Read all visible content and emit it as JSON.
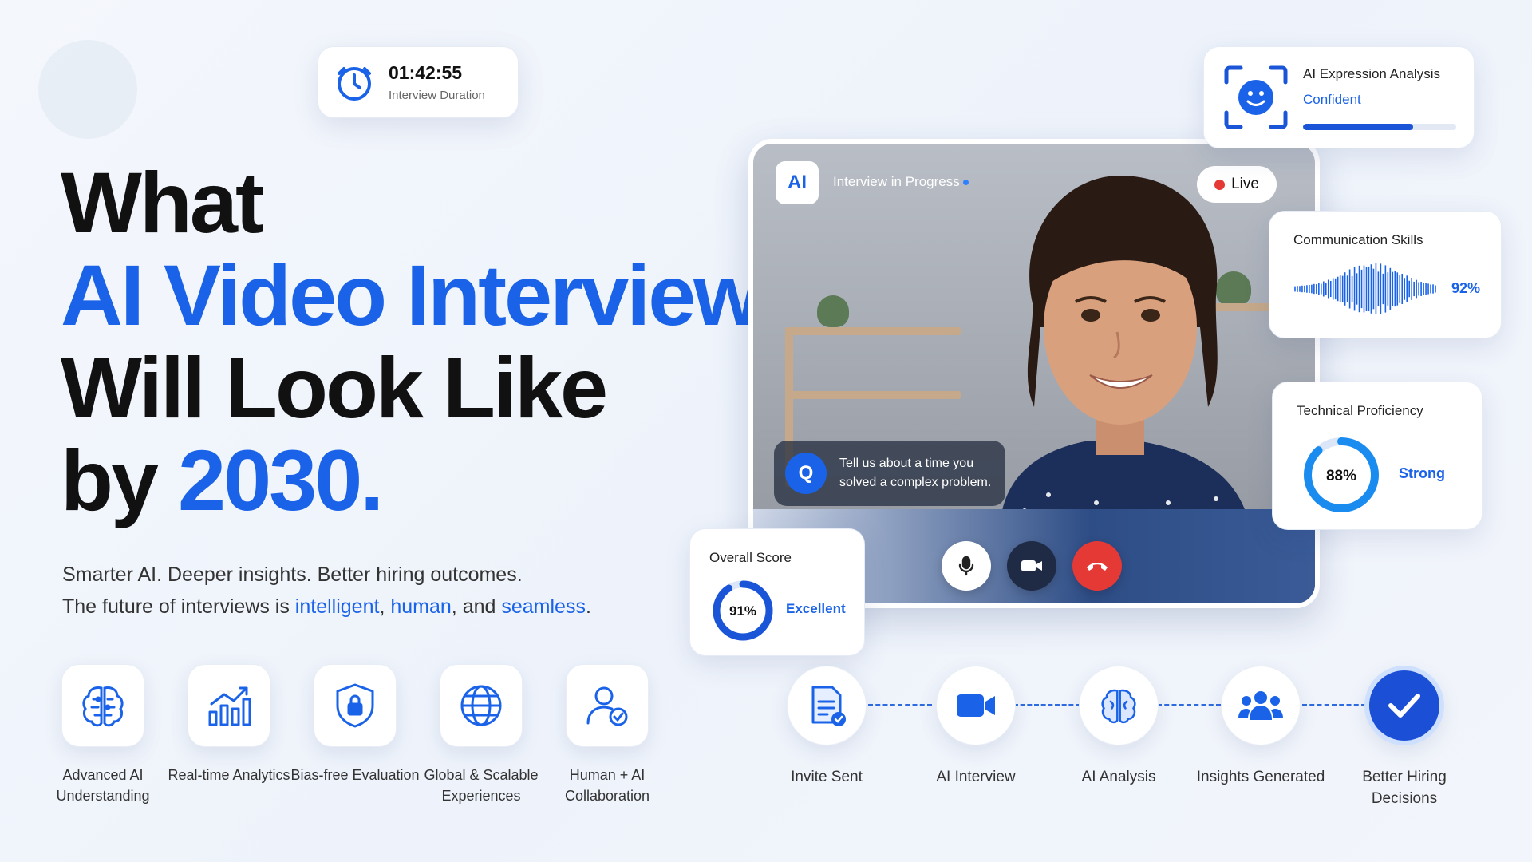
{
  "timer": {
    "time": "01:42:55",
    "label": "Interview Duration"
  },
  "headline": {
    "line1": "What",
    "line2": "AI Video Interviews",
    "line3": "Will Look Like",
    "line4_prefix": "by ",
    "line4_year": "2030."
  },
  "subtitle": {
    "line1": "Smarter AI. Deeper insights. Better hiring outcomes.",
    "line2_prefix": "The future of interviews is ",
    "word1": "intelligent",
    "sep1": ", ",
    "word2": "human",
    "sep2": ", and ",
    "word3": "seamless",
    "end": "."
  },
  "features": [
    {
      "label": "Advanced AI Understanding",
      "icon": "brain-icon"
    },
    {
      "label": "Real-time Analytics",
      "icon": "analytics-chart-icon"
    },
    {
      "label": "Bias-free Evaluation",
      "icon": "shield-lock-icon"
    },
    {
      "label": "Global & Scalable Experiences",
      "icon": "globe-icon"
    },
    {
      "label": "Human + AI Collaboration",
      "icon": "user-check-icon"
    }
  ],
  "video": {
    "badge": "AI",
    "status": "Interview in Progress",
    "live": "Live",
    "question_badge": "Q",
    "question_line1": "Tell us about a time you",
    "question_line2": "solved a complex problem."
  },
  "expression": {
    "title": "AI Expression Analysis",
    "value": "Confident",
    "level": 0.72
  },
  "communication": {
    "title": "Communication Skills",
    "value": "92%"
  },
  "technical": {
    "title": "Technical Proficiency",
    "percent": 88,
    "percent_label": "88%",
    "label": "Strong"
  },
  "overall": {
    "title": "Overall Score",
    "percent": 91,
    "percent_label": "91%",
    "label": "Excellent"
  },
  "steps": [
    {
      "label": "Invite Sent",
      "icon": "document-check-icon"
    },
    {
      "label": "AI Interview",
      "icon": "video-camera-icon"
    },
    {
      "label": "AI Analysis",
      "icon": "brain-icon"
    },
    {
      "label": "Insights Generated",
      "icon": "people-group-icon"
    },
    {
      "label": "Better Hiring Decisions",
      "icon": "checkmark-icon"
    }
  ],
  "colors": {
    "accent": "#1a63e8",
    "end_call": "#e53935",
    "dark": "#111111"
  }
}
